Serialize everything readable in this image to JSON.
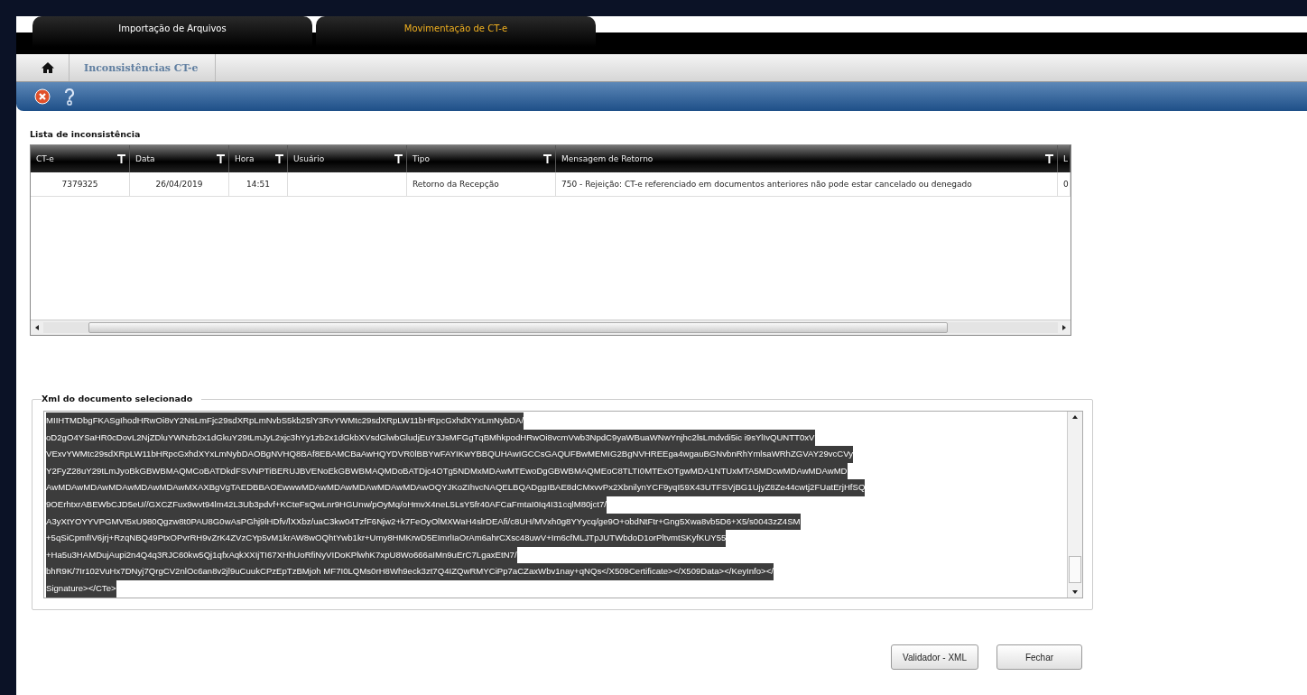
{
  "tabs": [
    {
      "label": "Importação de Arquivos",
      "selected": false
    },
    {
      "label": "Movimentação de CT-e",
      "selected": true
    }
  ],
  "breadcrumb": {
    "items": [
      "Inconsistências  CT-e"
    ]
  },
  "toolbar": {
    "buttons": [
      {
        "kind": "close"
      },
      {
        "kind": "help"
      }
    ]
  },
  "list": {
    "title": "Lista de inconsistência",
    "columns": [
      {
        "label": "CT-e",
        "filter": true
      },
      {
        "label": "Data",
        "filter": true
      },
      {
        "label": "Hora",
        "filter": true
      },
      {
        "label": "Usuário",
        "filter": true
      },
      {
        "label": "Tipo",
        "filter": true
      },
      {
        "label": "Mensagem de Retorno",
        "filter": true
      },
      {
        "label": "L",
        "filter": false
      }
    ],
    "rows": [
      {
        "cells": [
          "7379325",
          "26/04/2019",
          "14:51",
          "",
          "Retorno da Recepção",
          "750 - Rejeição: CT-e referenciado em documentos anteriores não pode estar cancelado ou denegado",
          "0"
        ],
        "selected": false
      }
    ]
  },
  "xml": {
    "title": "Xml do documento selecionado",
    "text_selected": true,
    "lines": [
      "MIIHTMDbgFKASgIhodHRwOi8vY2NsLmFjc29sdXRpLmNvbS5kb25lY3RvYWMtc29sdXRpLW11bHRpcGxhdXYxLmNybDA/",
      "oD2gO4YSaHR0cDovL2NjZDluYWNzb2x1dGkuY29tLmJyL2xjc3hYy1zb2x1dGkbXVsdGlwbGludjEuY3JsMFGgTqBMhkpodHRwOi8vcmVwb3NpdC9yaWBuaWNwYnjhc2lsLmdvdi5ic i9sYlIvQUNTT0xV",
      "VExvYWMtc29sdXRpLW11bHRpcGxhdXYxLmNybDAOBgNVHQ8BAf8EBAMCBaAwHQYDVR0lBBYwFAYIKwYBBQUHAwIGCCsGAQUFBwMEMIG2BgNVHREEga4wgauBGNvbnRhYmlsaWRhZGVAY29vcCVy",
      "Y2FyZ28uY29tLmJyoBkGBWBMAQMCoBATDkdFSVNPTiBERUJBVENoEkGBWBMAQMDoBATDjc4OTg5NDMxMDAwMTEwoDgGBWBMAQMEoC8TLTI0MTExOTgwMDA1NTUxMTA5MDcwMDAwMDAwMD",
      "AwMDAwMDAwMDAwMDAwMDAwMXAXBgVgTAEDBBAOEwwwMDAwMDAwMDAwMDAwMDAwOQYJKoZIhvcNAQELBQADggIBAE8dCMxvvPx2XbnilynYCF9yqI59X43UTFSVjBG1UjyZ8Ze44cwtj2FUatErjHfSQ",
      "9OErhtxrABEWbCJD5eU//GXCZFux9wvt94lm42L3Ub3pdvf+KCteFsQwLnr9HGUnw/pOyMq/oHmvX4neL5LsY5fr40AFCaFmtaI0Iq4I31cqlM80jct7/",
      "A3yXtYOYYVPGMVt5xU980Qgzw8t0PAU8G0wAsPGhj9lHDfv/lXXbz/uaC3kw04TzfF6Njw2+k7FeOyOlMXWaH4slrDEAfi/c8UH/MVxh0g8YYycq/ge9O+obdNtFtr+Gng5Xwa8vb5D6+X5/s0043zZ4SM",
      "+5qSiCpmfIV6jrj+RzqNBQ49PtxOPvrRH9vZrK4ZVzCYp5vM1krAW8wOQhtYwb1kr+Umy8HMKrwD5EImrlIaOrAm6ahrCXsc48uwV+Im6cfMLJTpJUTWbdoD1orPltvmtSKyfKUY55",
      "+Ha5u3HAMDujAupi2n4Q4q3RJC60kw5Qj1qfxAqkXXIjTI67XHhUoRfiNyVIDoKPlwhK7xpU8Wo666aIMn9uErC7LgaxEtN7/",
      "bhR9K/7Ir102VuHx7DNyj7QrgCV2nlOc6an8v2jl9uCuukCPzEpTzBMjoh MF7I0LQMs0rH8Wh9eck3zt7Q4IZQwRMYCiPp7aCZaxWbv1nay+qNQs</X509Certificate></X509Data></KeyInfo></",
      "Signature></CTe>"
    ]
  },
  "buttons": [
    {
      "label": "Validador - XML"
    },
    {
      "label": "Fechar"
    }
  ]
}
